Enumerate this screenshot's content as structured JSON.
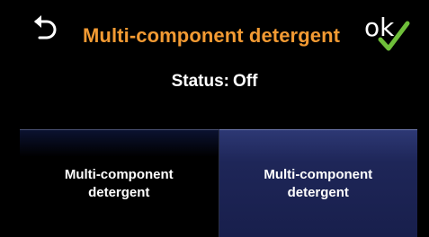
{
  "header": {
    "title": "Multi-component detergent",
    "ok_label": "ok",
    "back_icon": "back-arrow-icon",
    "ok_icon": "green-checkmark-icon"
  },
  "status": {
    "label": "Status:",
    "value": "Off"
  },
  "options": [
    {
      "label": "Multi-component detergent",
      "selected": false
    },
    {
      "label": "Multi-component detergent",
      "selected": true
    }
  ],
  "colors": {
    "title": "#f29a33",
    "background": "#000000",
    "selected_tile": "#1e2658",
    "checkmark": "#6fbf3a"
  }
}
